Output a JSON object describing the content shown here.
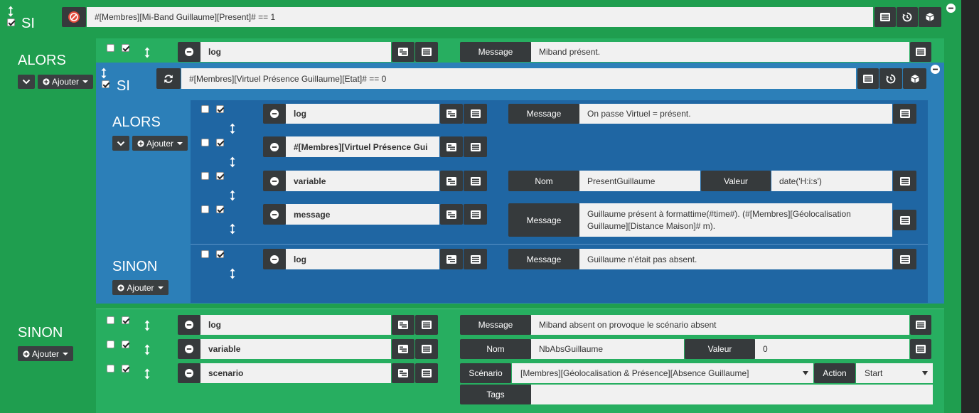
{
  "outer_if": {
    "keyword": "SI",
    "condition": "#[Membres][Mi-Band Guillaume][Present]# == 1"
  },
  "outer_then": {
    "keyword": "ALORS",
    "add_label": "Ajouter",
    "action_log": {
      "type": "log",
      "param_label": "Message",
      "param_value": "Miband présent."
    }
  },
  "nested_if": {
    "keyword": "SI",
    "condition": "#[Membres][Virtuel Présence Guillaume][Etat]#  == 0",
    "then_keyword": "ALORS",
    "add_label": "Ajouter",
    "actions": [
      {
        "type": "log",
        "param_label": "Message",
        "param_value": "On passe Virtuel = présent."
      },
      {
        "type": "#[Membres][Virtuel Présence Gui"
      },
      {
        "type": "variable",
        "name_label": "Nom",
        "name_value": "PresentGuillaume",
        "value_label": "Valeur",
        "value_value": "date('H:i:s')"
      },
      {
        "type": "message",
        "param_label": "Message",
        "param_value": "Guillaume présent à formattime(#time#). (#[Membres][Géolocalisation Guillaume][Distance Maison]# m)."
      }
    ],
    "else_keyword": "SINON",
    "else_add_label": "Ajouter",
    "else_action": {
      "type": "log",
      "param_label": "Message",
      "param_value": "Guillaume n'était pas absent."
    }
  },
  "outer_else": {
    "keyword": "SINON",
    "add_label": "Ajouter",
    "actions": [
      {
        "type": "log",
        "param_label": "Message",
        "param_value": "Miband absent on provoque le scénario absent"
      },
      {
        "type": "variable",
        "name_label": "Nom",
        "name_value": "NbAbsGuillaume",
        "value_label": "Valeur",
        "value_value": "0"
      },
      {
        "type": "scenario",
        "scenario_label": "Scénario",
        "scenario_value": "[Membres][Géolocalisation & Présence][Absence Guillaume]",
        "action_label": "Action",
        "action_value": "Start",
        "tags_label": "Tags",
        "tags_value": ""
      }
    ]
  },
  "colors": {
    "outer_green": "#1f9e4f",
    "inner_green": "#27ae60",
    "blue": "#2c7fb8",
    "dark_blue": "#1f66a3",
    "button_dark": "#363a3c",
    "input_bg": "#f1f1f1"
  }
}
